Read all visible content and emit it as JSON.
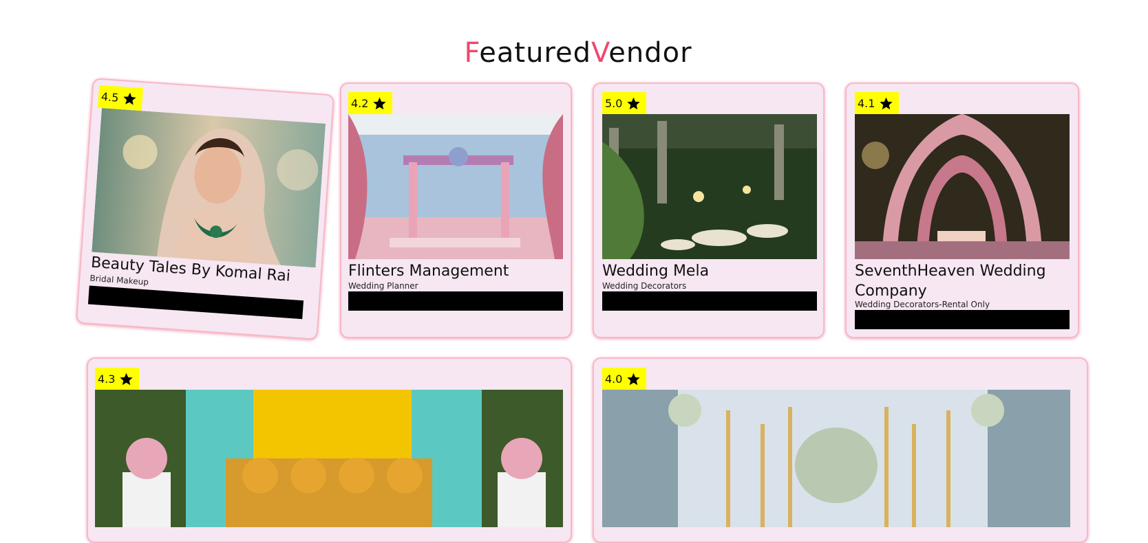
{
  "heading": {
    "first_initial": "F",
    "first_rest": "eatured",
    "second_initial": "V",
    "second_rest": "endor"
  },
  "colors": {
    "accent": "#ef476f",
    "card_bg": "#f6e7f2",
    "badge_bg": "#ffff00"
  },
  "icons": {
    "rating": "star-icon"
  },
  "vendors": [
    {
      "rating": "4.5",
      "name": "Beauty Tales By Komal Rai",
      "category": "Bridal Makeup"
    },
    {
      "rating": "4.2",
      "name": "Flinters Management",
      "category": "Wedding Planner"
    },
    {
      "rating": "5.0",
      "name": "Wedding Mela",
      "category": "Wedding Decorators"
    },
    {
      "rating": "4.1",
      "name": "SeventhHeaven Wedding Company",
      "category": "Wedding Decorators-Rental Only"
    },
    {
      "rating": "4.3",
      "name": "",
      "category": ""
    },
    {
      "rating": "4.0",
      "name": "",
      "category": ""
    }
  ]
}
